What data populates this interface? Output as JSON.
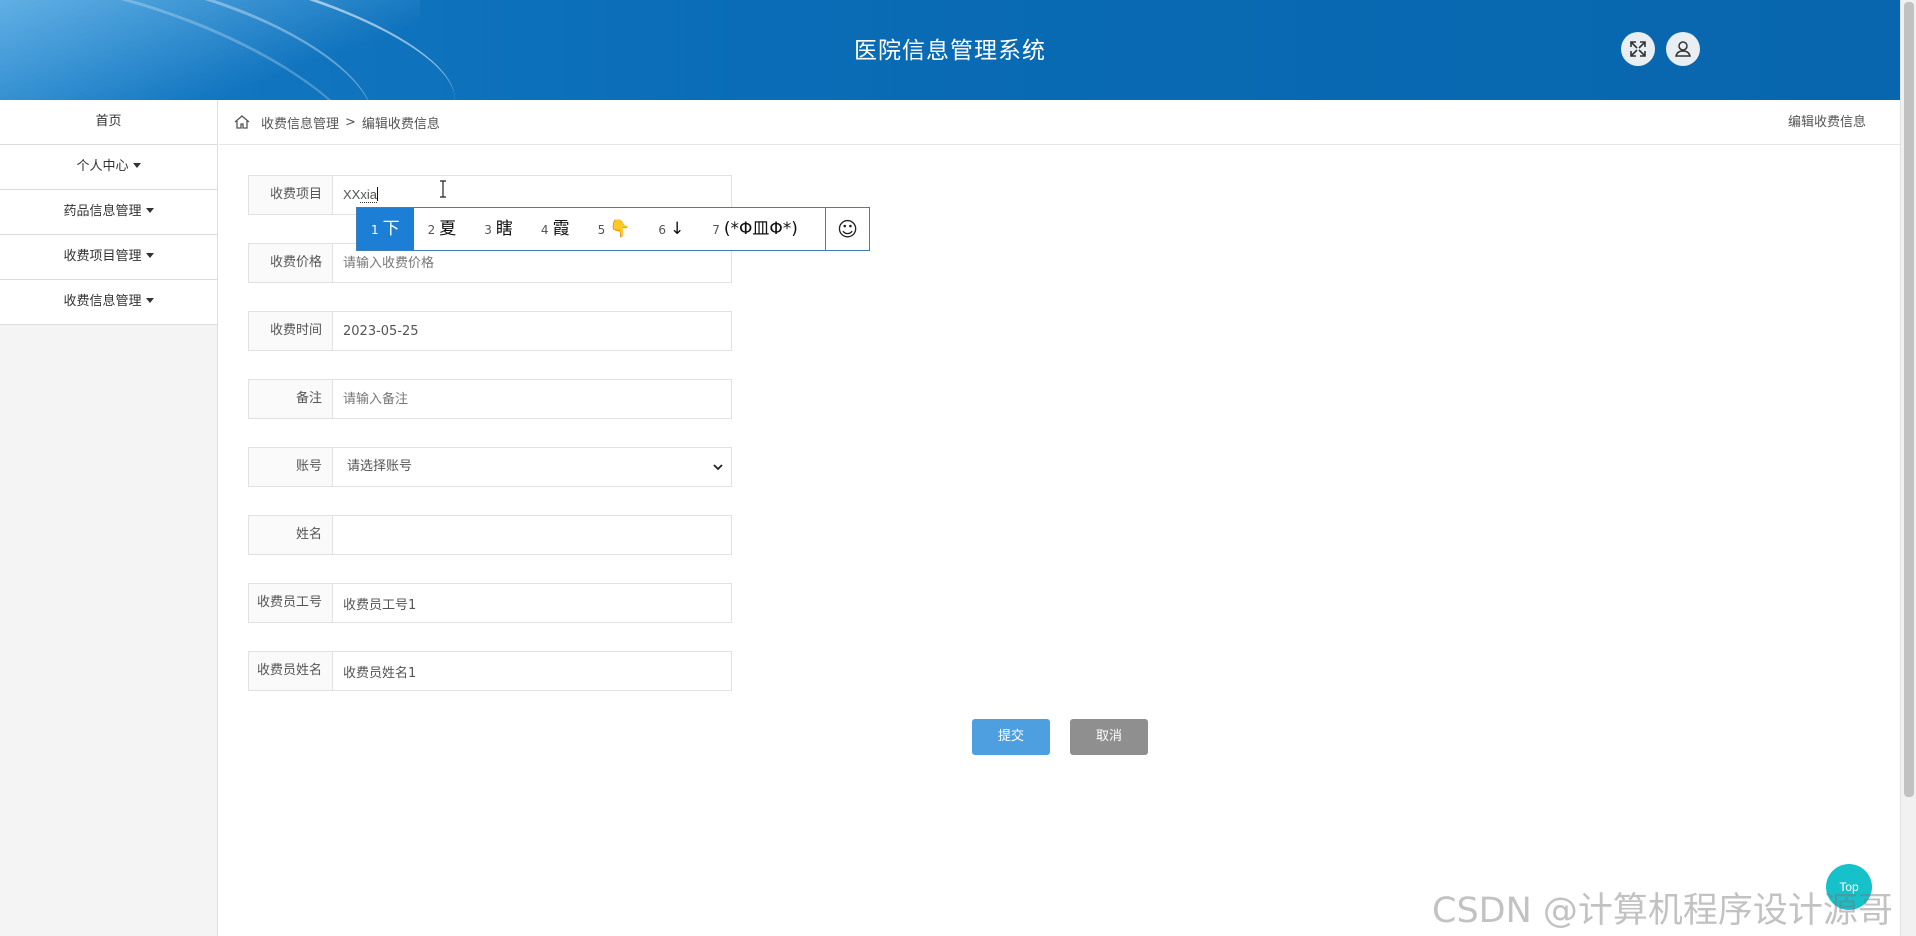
{
  "header": {
    "title": "医院信息管理系统"
  },
  "sidebar": {
    "items": [
      {
        "label": "首页",
        "dropdown": false
      },
      {
        "label": "个人中心",
        "dropdown": true
      },
      {
        "label": "药品信息管理",
        "dropdown": true
      },
      {
        "label": "收费项目管理",
        "dropdown": true
      },
      {
        "label": "收费信息管理",
        "dropdown": true
      }
    ]
  },
  "breadcrumb": {
    "parent": "收费信息管理",
    "separator": ">",
    "current": "编辑收费信息",
    "right": "编辑收费信息"
  },
  "form": {
    "item": {
      "label": "收费项目",
      "value_committed": "XX",
      "value_composing": "xia"
    },
    "price": {
      "label": "收费价格",
      "placeholder": "请输入收费价格",
      "value": ""
    },
    "time": {
      "label": "收费时间",
      "value": "2023-05-25"
    },
    "note": {
      "label": "备注",
      "placeholder": "请输入备注",
      "value": ""
    },
    "account": {
      "label": "账号",
      "selected": "请选择账号"
    },
    "name": {
      "label": "姓名",
      "value": ""
    },
    "cashier_id": {
      "label": "收费员工号",
      "value": "收费员工号1"
    },
    "cashier_name": {
      "label": "收费员姓名",
      "value": "收费员姓名1"
    }
  },
  "ime": {
    "candidates": [
      {
        "num": "1",
        "text": "下"
      },
      {
        "num": "2",
        "text": "夏"
      },
      {
        "num": "3",
        "text": "瞎"
      },
      {
        "num": "4",
        "text": "霞"
      },
      {
        "num": "5",
        "text": "👇"
      },
      {
        "num": "6",
        "text": "↓"
      },
      {
        "num": "7",
        "text": "(*Φ皿Φ*)"
      }
    ],
    "emoji_button": "☺"
  },
  "buttons": {
    "submit": "提交",
    "cancel": "取消"
  },
  "top_button": "Top",
  "watermark": "CSDN @计算机程序设计源哥",
  "colors": {
    "header": "#0a6cb6",
    "submit": "#4d9fe0",
    "cancel": "#8f8f8f",
    "ime_active": "#1d7ed6",
    "top": "#17c1c9"
  }
}
